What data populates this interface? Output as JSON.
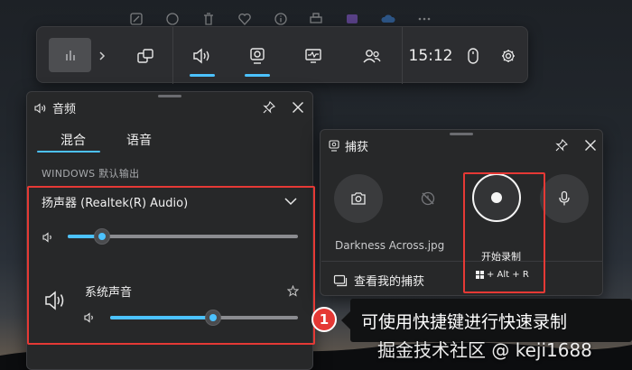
{
  "game_bar": {
    "time": "15:12"
  },
  "audio_panel": {
    "title": "音频",
    "tabs": [
      "混合",
      "语音"
    ],
    "section_label": "WINDOWS 默认输出",
    "device_name": "扬声器 (Realtek(R) Audio)",
    "device_volume": 0.15,
    "app_name": "系统声音",
    "app_volume": 0.55
  },
  "capture_panel": {
    "title": "捕获",
    "last_capture": "Darkness Across.jpg",
    "view_captures": "查看我的捕获",
    "record_label": "开始录制",
    "record_shortcut": "+ Alt + R"
  },
  "annotation": {
    "badge": "1",
    "tip": "可使用快捷键进行快速录制"
  },
  "watermark": "掘金技术社区 @ keji1688",
  "colors": {
    "accent": "#4cc2ff",
    "highlight_box": "#e53935",
    "panel_bg": "#272829"
  }
}
